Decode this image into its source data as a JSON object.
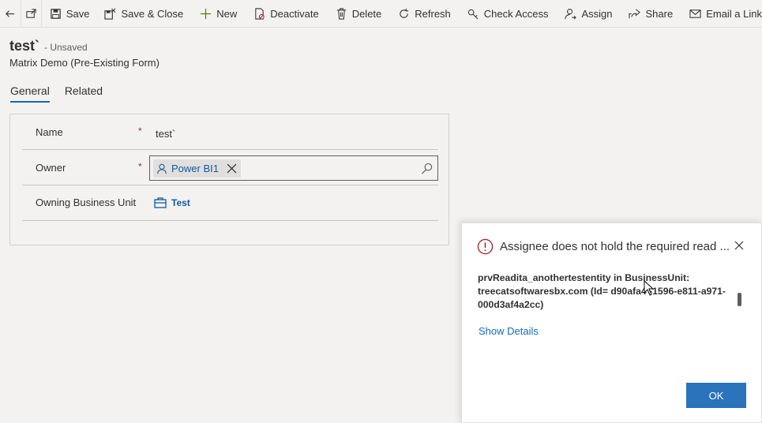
{
  "toolbar": {
    "save": "Save",
    "save_close": "Save & Close",
    "new": "New",
    "deactivate": "Deactivate",
    "delete": "Delete",
    "refresh": "Refresh",
    "check_access": "Check Access",
    "assign": "Assign",
    "share": "Share",
    "email_link": "Email a Link"
  },
  "header": {
    "record_name": "test`",
    "status": "- Unsaved",
    "form_name": "Matrix Demo (Pre-Existing Form)"
  },
  "tabs": [
    {
      "label": "General",
      "active": true
    },
    {
      "label": "Related",
      "active": false
    }
  ],
  "form": {
    "name_label": "Name",
    "name_value": "test`",
    "owner_label": "Owner",
    "owner_value": "Power BI1",
    "bu_label": "Owning Business Unit",
    "bu_value": "Test",
    "required_marker": "*"
  },
  "dialog": {
    "title": "Assignee does not hold the required read ...",
    "message": "prvReadita_anothertestentity in BusinessUnit: treecatsoftwaresbx.com (Id= d90afa4 -1596-e811-a971-000d3af4a2cc)",
    "details_link": "Show Details",
    "ok_label": "OK"
  },
  "colors": {
    "accent": "#0f6cbd",
    "ok_button": "#2b73bd",
    "error": "#a4262c",
    "background": "#f3f2f1"
  }
}
